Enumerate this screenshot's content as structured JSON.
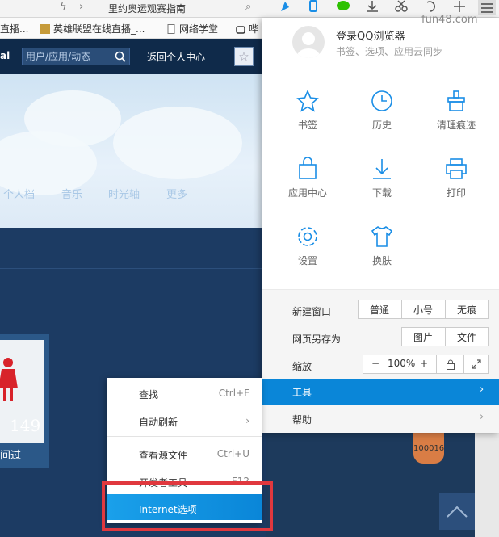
{
  "tabbar": {
    "tab_title": "里约奥运观赛指南"
  },
  "bookmarks": [
    {
      "label": "直播..."
    },
    {
      "label": "英雄联盟在线直播_..."
    },
    {
      "label": "网络学堂"
    },
    {
      "label": "哔"
    }
  ],
  "watermark": "fun48.com",
  "site": {
    "search_placeholder": "用户/应用/动态",
    "back_link": "返回个人中心",
    "nav_tabs": [
      "个人档",
      "音乐",
      "时光轴",
      "更多"
    ],
    "card_number": "149",
    "card_caption": "间过",
    "badge_number": "100016"
  },
  "qq_menu": {
    "login_title": "登录QQ浏览器",
    "login_subtitle": "书签、选项、应用云同步",
    "buttons": [
      {
        "label": "书签",
        "icon": "star-icon"
      },
      {
        "label": "历史",
        "icon": "clock-icon"
      },
      {
        "label": "清理痕迹",
        "icon": "broom-icon"
      },
      {
        "label": "应用中心",
        "icon": "bag-icon"
      },
      {
        "label": "下载",
        "icon": "download-icon"
      },
      {
        "label": "打印",
        "icon": "printer-icon"
      },
      {
        "label": "设置",
        "icon": "gear-icon"
      },
      {
        "label": "换肤",
        "icon": "shirt-icon"
      }
    ],
    "new_window": {
      "label": "新建窗口",
      "options": [
        "普通",
        "小号",
        "无痕"
      ]
    },
    "save_as": {
      "label": "网页另存为",
      "options": [
        "图片",
        "文件"
      ]
    },
    "zoom": {
      "label": "缩放",
      "minus": "−",
      "value": "100%",
      "plus": "+"
    },
    "tools": "工具",
    "help": "帮助"
  },
  "submenu": {
    "items": [
      {
        "label": "查找",
        "shortcut": "Ctrl+F"
      },
      {
        "label": "自动刷新",
        "shortcut": "›"
      },
      {
        "label": "查看源文件",
        "shortcut": "Ctrl+U"
      },
      {
        "label": "开发者工具",
        "shortcut": "F12"
      }
    ],
    "highlighted": "Internet选项"
  },
  "colors": {
    "accent": "#0a86d8",
    "highlight_border": "#e0383e",
    "page_dark": "#1c3b63"
  }
}
